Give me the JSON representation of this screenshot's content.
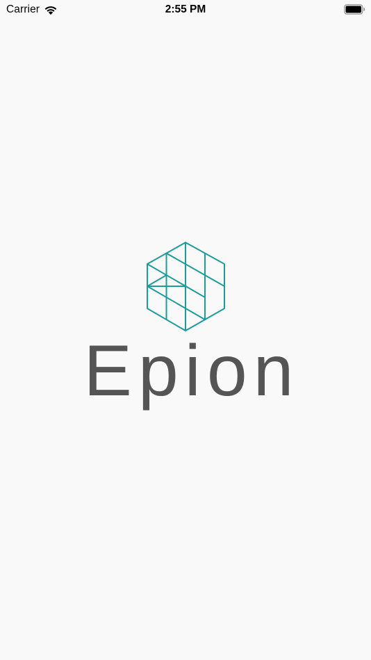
{
  "status_bar": {
    "carrier": "Carrier",
    "time": "2:55 PM",
    "wifi_icon": "wifi-icon",
    "battery_icon": "battery-full-icon"
  },
  "splash": {
    "logo_icon": "hexagon-grid-logo-icon",
    "brand_name": "Epion"
  },
  "colors": {
    "background": "#f9f9f9",
    "logo_teal": "#1a9e9a",
    "wordmark_gray": "#555555",
    "status_text": "#000000"
  }
}
